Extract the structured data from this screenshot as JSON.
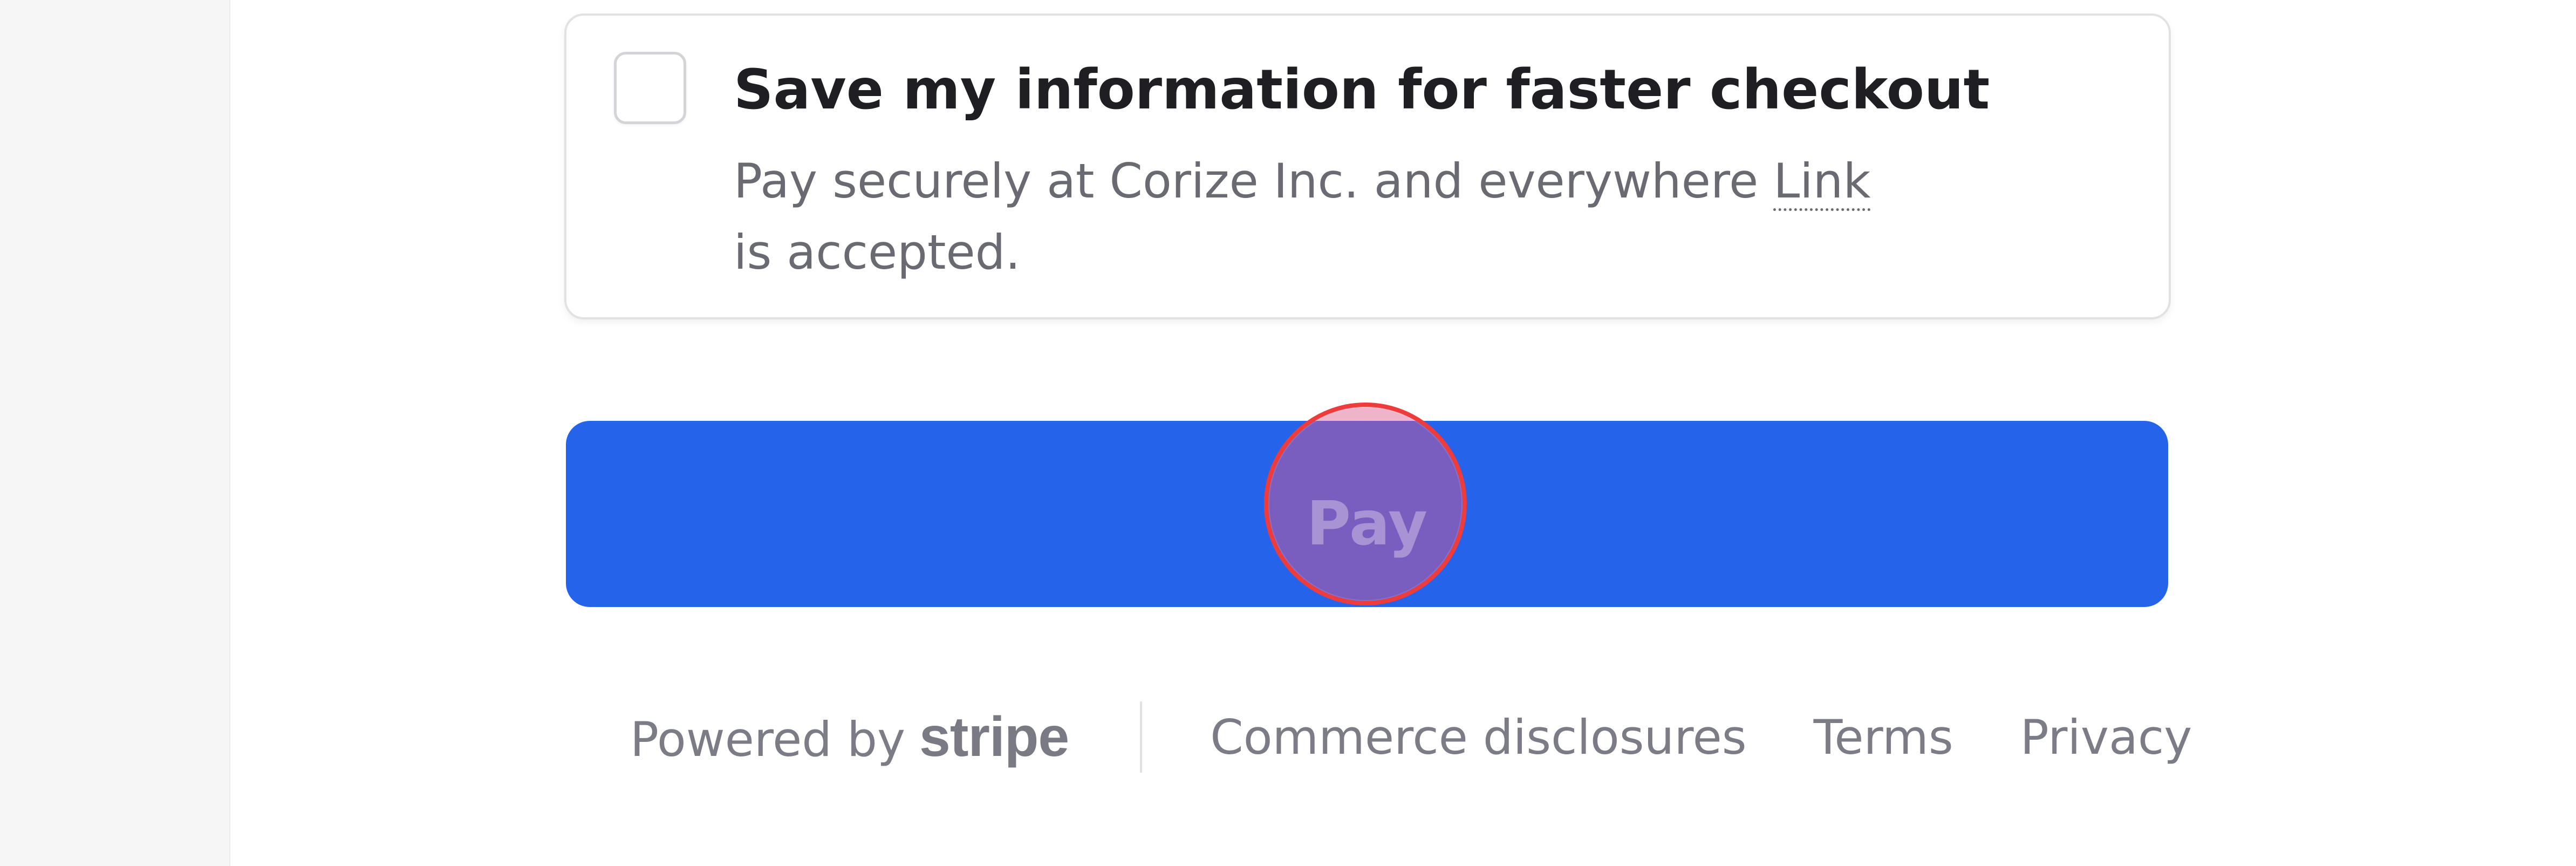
{
  "save_info": {
    "checked": false,
    "title": "Save my information for faster checkout",
    "description_before": "Pay securely at Corize Inc. and everywhere ",
    "link_text": "Link",
    "description_after": " is accepted."
  },
  "pay_button": {
    "label": "Pay",
    "color": "#2563eb"
  },
  "footer": {
    "powered_by": "Powered by",
    "brand": "stripe",
    "links": [
      "Commerce disclosures",
      "Terms",
      "Privacy"
    ]
  },
  "colors": {
    "click_marker": "#ee3b3b",
    "text_primary": "#1f1f23",
    "text_muted": "#6a6a72"
  }
}
